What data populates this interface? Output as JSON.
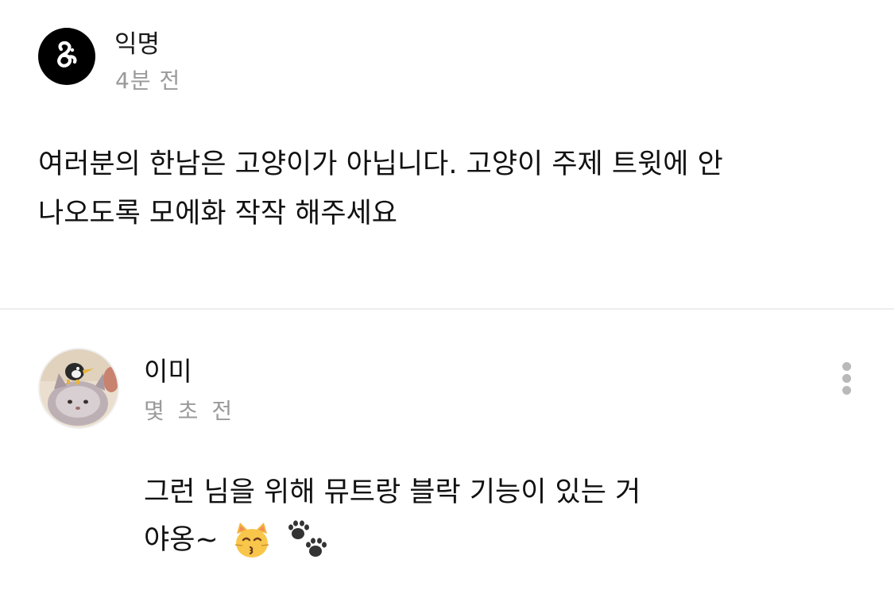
{
  "post": {
    "author": "익명",
    "time": "4분 전",
    "body_line1": "여러분의 한남은 고양이가 아닙니다. 고양이 주제 트윗에 안",
    "body_line2": "나오도록 모에화 작작 해주세요"
  },
  "comment": {
    "author": "이미",
    "time": "몇 초 전",
    "body_line1": "그런 님을 위해 뮤트랑 블락 기능이 있는 거",
    "body_line2": "야옹~",
    "emojis": [
      "kissing-cat-emoji",
      "paw-prints-emoji"
    ]
  },
  "colors": {
    "text": "#111111",
    "muted": "#9a9a9a",
    "divider": "#ececec",
    "avatar_bg": "#000000",
    "more_dots": "#b9b9b9"
  }
}
